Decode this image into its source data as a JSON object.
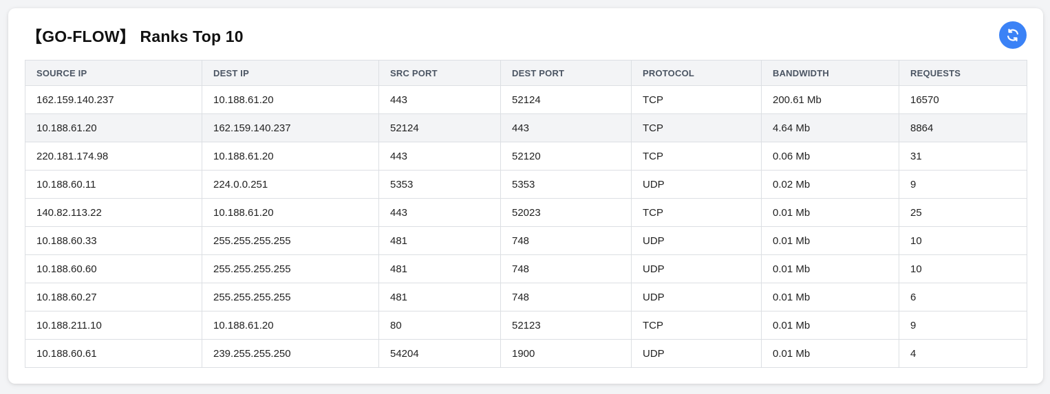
{
  "page": {
    "title": "【GO-FLOW】 Ranks Top 10",
    "refresh_icon": "refresh-icon",
    "accent_color": "#3b82f6"
  },
  "table": {
    "headers": [
      "SOURCE IP",
      "DEST IP",
      "SRC PORT",
      "DEST PORT",
      "PROTOCOL",
      "BANDWIDTH",
      "REQUESTS"
    ],
    "rows": [
      [
        "162.159.140.237",
        "10.188.61.20",
        "443",
        "52124",
        "TCP",
        "200.61 Mb",
        "16570"
      ],
      [
        "10.188.61.20",
        "162.159.140.237",
        "52124",
        "443",
        "TCP",
        "4.64 Mb",
        "8864"
      ],
      [
        "220.181.174.98",
        "10.188.61.20",
        "443",
        "52120",
        "TCP",
        "0.06 Mb",
        "31"
      ],
      [
        "10.188.60.11",
        "224.0.0.251",
        "5353",
        "5353",
        "UDP",
        "0.02 Mb",
        "9"
      ],
      [
        "140.82.113.22",
        "10.188.61.20",
        "443",
        "52023",
        "TCP",
        "0.01 Mb",
        "25"
      ],
      [
        "10.188.60.33",
        "255.255.255.255",
        "481",
        "748",
        "UDP",
        "0.01 Mb",
        "10"
      ],
      [
        "10.188.60.60",
        "255.255.255.255",
        "481",
        "748",
        "UDP",
        "0.01 Mb",
        "10"
      ],
      [
        "10.188.60.27",
        "255.255.255.255",
        "481",
        "748",
        "UDP",
        "0.01 Mb",
        "6"
      ],
      [
        "10.188.211.10",
        "10.188.61.20",
        "80",
        "52123",
        "TCP",
        "0.01 Mb",
        "9"
      ],
      [
        "10.188.60.61",
        "239.255.255.250",
        "54204",
        "1900",
        "UDP",
        "0.01 Mb",
        "4"
      ]
    ]
  }
}
